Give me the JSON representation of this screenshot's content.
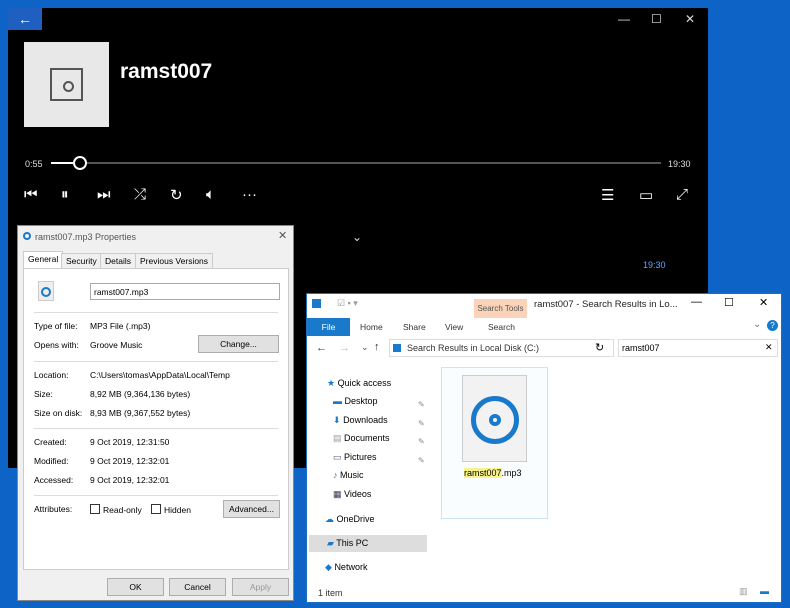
{
  "player": {
    "track_title": "ramst007",
    "elapsed": "0:55",
    "duration": "19:30",
    "progress_fraction": 0.047,
    "secondary_time": "19:30",
    "icons": [
      "back-arrow-icon",
      "minimize-icon",
      "maximize-icon",
      "close-icon",
      "previous-icon",
      "pause-icon",
      "next-icon",
      "shuffle-icon",
      "repeat-icon",
      "volume-icon",
      "more-icon",
      "playlist-icon",
      "mini-player-icon",
      "fullscreen-icon",
      "chevron-down-icon"
    ]
  },
  "properties": {
    "title": "ramst007.mp3 Properties",
    "tabs": [
      "General",
      "Security",
      "Details",
      "Previous Versions"
    ],
    "filename": "ramst007.mp3",
    "rows": [
      {
        "label": "Type of file:",
        "value": "MP3 File (.mp3)"
      },
      {
        "label": "Opens with:",
        "value": "Groove Music"
      },
      {
        "label": "Location:",
        "value": "C:\\Users\\tomas\\AppData\\Local\\Temp"
      },
      {
        "label": "Size:",
        "value": "8,92 MB (9,364,136 bytes)"
      },
      {
        "label": "Size on disk:",
        "value": "8,93 MB (9,367,552 bytes)"
      },
      {
        "label": "Created:",
        "value": "9 Oct 2019, 12:31:50"
      },
      {
        "label": "Modified:",
        "value": "9 Oct 2019, 12:32:01"
      },
      {
        "label": "Accessed:",
        "value": "9 Oct 2019, 12:32:01"
      }
    ],
    "attributes_label": "Attributes:",
    "readonly": "Read-only",
    "hidden": "Hidden",
    "change": "Change...",
    "advanced": "Advanced...",
    "ok": "OK",
    "cancel": "Cancel",
    "apply": "Apply"
  },
  "explorer": {
    "title": "ramst007 - Search Results in Lo...",
    "search_tools": "Search Tools",
    "ribbon": [
      "File",
      "Home",
      "Share",
      "View",
      "Search"
    ],
    "address": "Search Results in Local Disk (C:)",
    "search_value": "ramst007",
    "nav": [
      "Quick access",
      "Desktop",
      "Downloads",
      "Documents",
      "Pictures",
      "Music",
      "Videos",
      "OneDrive",
      "This PC",
      "Network"
    ],
    "file_highlight": "ramst007",
    "file_ext": ".mp3",
    "status": "1 item",
    "accent": "#1979ca"
  }
}
